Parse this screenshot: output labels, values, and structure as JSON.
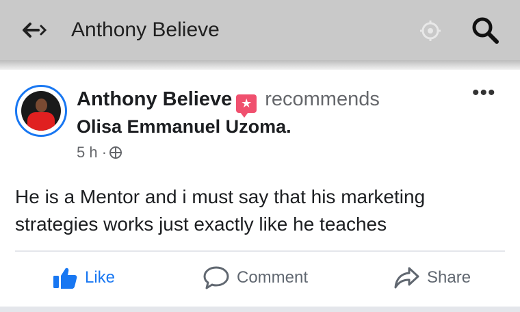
{
  "topbar": {
    "title": "Anthony Believe",
    "back_icon": "back-arrow-icon",
    "mid_icon": "location-icon",
    "search_icon": "search-icon"
  },
  "post": {
    "author": "Anthony Believe",
    "recommends": "recommends",
    "page_name": "Olisa Emmanuel Uzoma.",
    "time": "5 h ·",
    "body": "He is a Mentor and i must say that his marketing strategies works just exactly like he teaches",
    "more": "•••"
  },
  "actions": {
    "like": "Like",
    "comment": "Comment",
    "share": "Share"
  },
  "colors": {
    "accent": "#1877f2",
    "badge": "#f0506e",
    "topbar": "#c9c9c9"
  }
}
